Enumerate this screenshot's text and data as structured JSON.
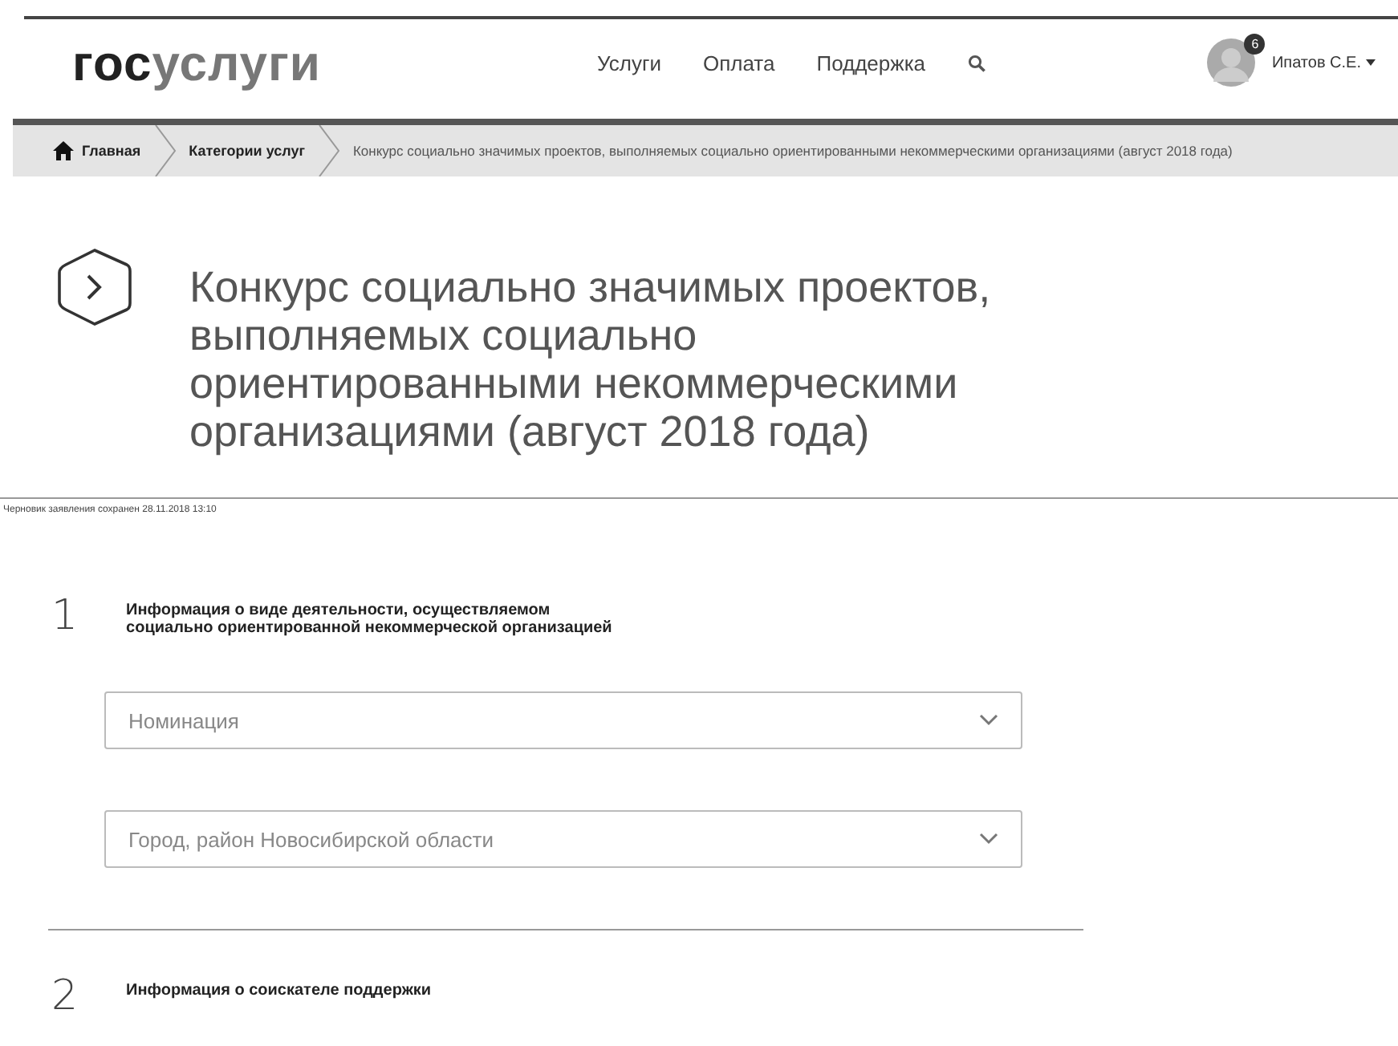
{
  "header": {
    "logo": {
      "part_1": "гос",
      "part_2": "услуги"
    },
    "nav": [
      "Услуги",
      "Оплата",
      "Поддержка"
    ],
    "user": {
      "badge": "6",
      "name": "Ипатов С.Е."
    }
  },
  "breadcrumbs": [
    {
      "label": "Главная",
      "kind": "home"
    },
    {
      "label": "Категории услуг",
      "kind": "link"
    },
    {
      "label": "Конкурс социально значимых проектов, выполняемых социально ориентированными некоммерческими организациями (август 2018 года)",
      "kind": "current"
    }
  ],
  "page_title": "Конкурс социально значимых проектов, выполняемых социально ориентированными некоммерческими организациями (август 2018 года)",
  "draft_note": "Черновик заявления сохранен 28.11.2018 13:10",
  "steps": [
    {
      "number": "1",
      "title": "Информация о виде деятельности, осуществляемом социально ориентированной некоммерческой организацией",
      "fields": [
        {
          "placeholder": "Номинация"
        },
        {
          "placeholder": "Город, район Новосибирской области"
        }
      ]
    },
    {
      "number": "2",
      "title": "Информация о соискателе поддержки"
    }
  ]
}
